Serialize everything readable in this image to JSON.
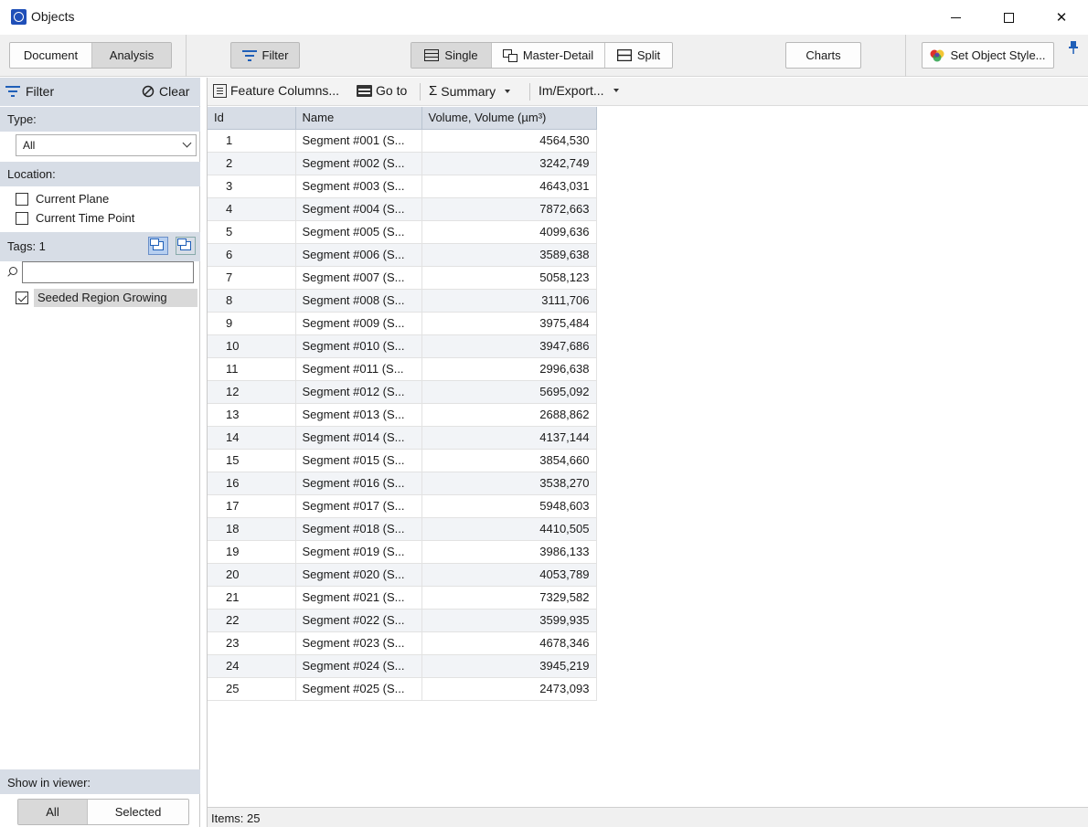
{
  "window": {
    "title": "Objects"
  },
  "toolbar": {
    "document_label": "Document",
    "analysis_label": "Analysis",
    "filter_label": "Filter",
    "single_label": "Single",
    "master_detail_label": "Master-Detail",
    "split_label": "Split",
    "charts_label": "Charts",
    "set_style_label": "Set Object Style..."
  },
  "filter": {
    "title": "Filter",
    "clear_label": "Clear",
    "type_label": "Type:",
    "type_value": "All",
    "location_label": "Location:",
    "current_plane_label": "Current Plane",
    "current_time_point_label": "Current Time Point",
    "tags_label": "Tags: 1",
    "search_placeholder": "",
    "tag_item_label": "Seeded Region Growing",
    "show_in_viewer_label": "Show in viewer:",
    "show_all_label": "All",
    "show_selected_label": "Selected"
  },
  "main_toolbar": {
    "feature_columns_label": "Feature Columns...",
    "goto_label": "Go to",
    "summary_label": "Summary",
    "imexport_label": "Im/Export..."
  },
  "table": {
    "columns": [
      "Id",
      "Name",
      "Volume, Volume (µm³)"
    ],
    "rows": [
      [
        "1",
        "Segment #001 (S...",
        "4564,530"
      ],
      [
        "2",
        "Segment #002 (S...",
        "3242,749"
      ],
      [
        "3",
        "Segment #003 (S...",
        "4643,031"
      ],
      [
        "4",
        "Segment #004 (S...",
        "7872,663"
      ],
      [
        "5",
        "Segment #005 (S...",
        "4099,636"
      ],
      [
        "6",
        "Segment #006 (S...",
        "3589,638"
      ],
      [
        "7",
        "Segment #007 (S...",
        "5058,123"
      ],
      [
        "8",
        "Segment #008 (S...",
        "3111,706"
      ],
      [
        "9",
        "Segment #009 (S...",
        "3975,484"
      ],
      [
        "10",
        "Segment #010 (S...",
        "3947,686"
      ],
      [
        "11",
        "Segment #011 (S...",
        "2996,638"
      ],
      [
        "12",
        "Segment #012 (S...",
        "5695,092"
      ],
      [
        "13",
        "Segment #013 (S...",
        "2688,862"
      ],
      [
        "14",
        "Segment #014 (S...",
        "4137,144"
      ],
      [
        "15",
        "Segment #015 (S...",
        "3854,660"
      ],
      [
        "16",
        "Segment #016 (S...",
        "3538,270"
      ],
      [
        "17",
        "Segment #017 (S...",
        "5948,603"
      ],
      [
        "18",
        "Segment #018 (S...",
        "4410,505"
      ],
      [
        "19",
        "Segment #019 (S...",
        "3986,133"
      ],
      [
        "20",
        "Segment #020 (S...",
        "4053,789"
      ],
      [
        "21",
        "Segment #021 (S...",
        "7329,582"
      ],
      [
        "22",
        "Segment #022 (S...",
        "3599,935"
      ],
      [
        "23",
        "Segment #023 (S...",
        "4678,346"
      ],
      [
        "24",
        "Segment #024 (S...",
        "3945,219"
      ],
      [
        "25",
        "Segment #025 (S...",
        "2473,093"
      ]
    ]
  },
  "status": {
    "items_label": "Items: 25"
  }
}
